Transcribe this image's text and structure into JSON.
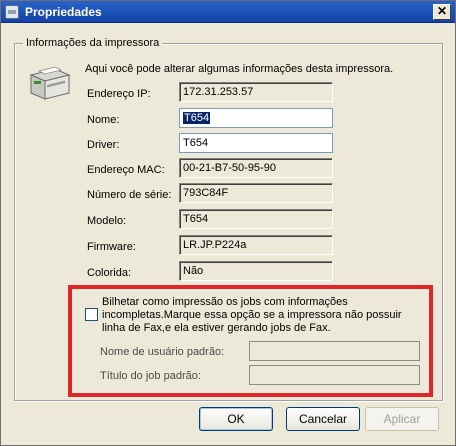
{
  "window": {
    "title": "Propriedades",
    "close_symbol": "✕"
  },
  "group": {
    "legend": "Informações da impressora",
    "intro": "Aqui você pode alterar algumas informações desta impressora."
  },
  "fields": {
    "ip": {
      "label": "Endereço IP:",
      "value": "172.31.253.57"
    },
    "name": {
      "label": "Nome:",
      "value": "T654"
    },
    "driver": {
      "label": "Driver:",
      "value": "T654"
    },
    "mac": {
      "label": "Endereço MAC:",
      "value": "00-21-B7-50-95-90"
    },
    "serial": {
      "label": "Número de série:",
      "value": "793C84F"
    },
    "model": {
      "label": "Modelo:",
      "value": "T654"
    },
    "firmware": {
      "label": "Firmware:",
      "value": "LR.JP.P224a"
    },
    "color": {
      "label": "Colorida:",
      "value": "Não"
    }
  },
  "billing": {
    "checkbox_label": "Bilhetar como impressão os jobs com informações incompletas.Marque essa opção se a impressora não possuir linha de Fax,e ela estiver gerando jobs de Fax.",
    "checked": false,
    "default_user_label": "Nome de usuário padrão:",
    "default_user_value": "",
    "default_job_label": "Título do job padrão:",
    "default_job_value": ""
  },
  "buttons": {
    "ok": "OK",
    "cancel": "Cancelar",
    "apply": "Aplicar"
  },
  "colors": {
    "titlebar": "#1c4fb8",
    "highlight_box": "#e0252b",
    "selection": "#0a246a"
  }
}
